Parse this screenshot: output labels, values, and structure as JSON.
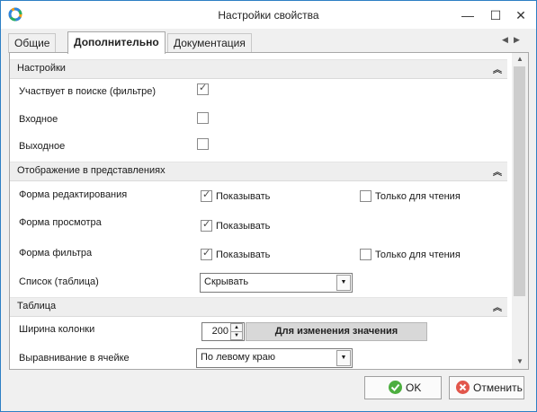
{
  "window": {
    "title": "Настройки свойства"
  },
  "tabs": [
    "Общие",
    "Дополнительно",
    "Документация"
  ],
  "sections": {
    "settings": {
      "title": "Настройки",
      "rows": [
        {
          "label": "Участвует в поиске (фильтре)",
          "checked": true
        },
        {
          "label": "Входное",
          "checked": false
        },
        {
          "label": "Выходное",
          "checked": false
        }
      ]
    },
    "display": {
      "title": "Отображение в представлениях",
      "rows": [
        {
          "label": "Форма редактирования",
          "show_label": "Показывать",
          "show_checked": true,
          "readonly_label": "Только для чтения",
          "readonly_checked": false
        },
        {
          "label": "Форма просмотра",
          "show_label": "Показывать",
          "show_checked": true
        },
        {
          "label": "Форма фильтра",
          "show_label": "Показывать",
          "show_checked": true,
          "readonly_label": "Только для чтения",
          "readonly_checked": false
        }
      ],
      "list": {
        "label": "Список (таблица)",
        "value": "Скрывать"
      }
    },
    "table": {
      "title": "Таблица",
      "width": {
        "label": "Ширина колонки",
        "value": "200",
        "button_label": "Для изменения значения"
      },
      "align": {
        "label": "Выравнивание в ячейке",
        "value": "По левому краю"
      }
    }
  },
  "footer": {
    "ok_label": "OK",
    "cancel_label": "Отменить"
  },
  "colors": {
    "accent_border": "#2d7fc4",
    "ok_icon": "#4cae3f",
    "cancel_icon": "#e2574c"
  }
}
